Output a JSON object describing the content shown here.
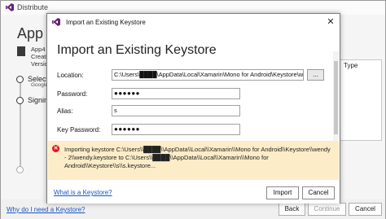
{
  "background": {
    "window_title": "Distribute",
    "heading": "App Di",
    "app_info": [
      "App4",
      "Creatio",
      "Version"
    ],
    "steps": [
      {
        "label": "Select C",
        "sub": "Google"
      },
      {
        "label": "Signing",
        "sub": ""
      }
    ],
    "right_panel_header": "Type",
    "help_link": "Why do I need a Keystore?",
    "buttons": {
      "back": "Back",
      "continue": "Continue",
      "cancel": "Cancel"
    }
  },
  "dialog": {
    "title": "Import an Existing Keystore",
    "heading": "Import an Existing Keystore",
    "close_glyph": "✕",
    "fields": {
      "location_label": "Location:",
      "location_value": "C:\\Users\\████\\AppData\\Local\\Xamarin\\Mono for Android\\Keystore\\wendy",
      "browse_label": "...",
      "password_label": "Password:",
      "password_value": "●●●●●●",
      "alias_label": "Alias:",
      "alias_value": "s",
      "key_password_label": "Key Password:",
      "key_password_value": "●●●●●●"
    },
    "error": {
      "icon_glyph": "✕",
      "message": "Importing keystore C:\\Users\\\\████\\\\AppData\\\\Local\\\\Xamarin\\\\Mono for Android\\\\Keystore\\\\wendy - 2\\\\wendy.keystore to C:\\Users\\\\████\\\\AppData\\\\Local\\\\Xamarin\\\\Mono for Android\\\\Keystore\\\\s\\\\s.keystore..."
    },
    "footer": {
      "what_link": "What is a Keystore?",
      "import_label": "Import",
      "cancel_label": "Cancel"
    }
  },
  "colors": {
    "error_background": "#fdecc8",
    "error_icon": "#e81123",
    "link": "#1a55c0",
    "vs_purple": "#68217a"
  }
}
